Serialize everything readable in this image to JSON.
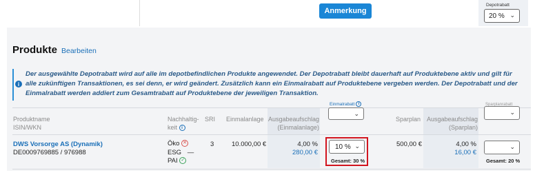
{
  "toolbar": {
    "anmerkung_label": "Anmerkung"
  },
  "depot": {
    "label": "Depotrabatt",
    "value": "20 %"
  },
  "section": {
    "title": "Produkte",
    "edit_label": "Bearbeiten"
  },
  "info": {
    "icon": "info-icon",
    "line1": "Der ausgewählte Depotrabatt wird auf alle im depotbefindlichen Produkte angewendet. Der Depotrabatt bleibt dauerhaft auf Produktebene aktiv und gilt für",
    "line2": "alle zukünftigen Transaktionen, es sei denn, er wird geändert. Zusätzlich kann ein Einmalrabatt auf Produktebene vergeben werden. Der Depotrabatt und der",
    "line3": "Einmalrabatt werden addiert zum Gesamtrabatt auf Produktebene der jeweiligen Transaktion."
  },
  "table": {
    "headers": {
      "produktname": "Produktname",
      "isin": "ISIN/WKN",
      "nachhaltig_1": "Nachhaltig-",
      "nachhaltig_2": "keit",
      "sri": "SRI",
      "einmalanlage": "Einmalanlage",
      "ausgabe_einmal_1": "Ausgabeaufschlag",
      "ausgabe_einmal_2": "(Einmalanlage)",
      "einmalrabatt": "Einmalrabatt",
      "sparplan": "Sparplan",
      "ausgabe_spar_1": "Ausgabeaufschlag",
      "ausgabe_spar_2": "(Sparplan)",
      "sparplanrabatt": "Sparplanrabatt"
    },
    "row": {
      "name": "DWS Vorsorge AS (Dynamik)",
      "isin_wkn": "DE0009769885 / 976988",
      "oeko": "Öko",
      "esg": "ESG",
      "esg_value": "—",
      "pai": "PAI",
      "sri": "3",
      "einmalanlage": "10.000,00 €",
      "ausgabe_einmal_pct": "4,00 %",
      "ausgabe_einmal_eur": "280,00 €",
      "einmalrabatt_value": "10 %",
      "einmalrabatt_total": "Gesamt: 30 %",
      "sparplan": "500,00 €",
      "ausgabe_spar_pct": "4,00 %",
      "ausgabe_spar_eur": "16,00 €",
      "sparplan_total": "Gesamt: 20 %"
    }
  },
  "colors": {
    "accent": "#1a86d6",
    "link": "#1a6fb8",
    "highlight": "#d2141e",
    "negative": "#d9534f",
    "positive": "#3aa35a"
  }
}
